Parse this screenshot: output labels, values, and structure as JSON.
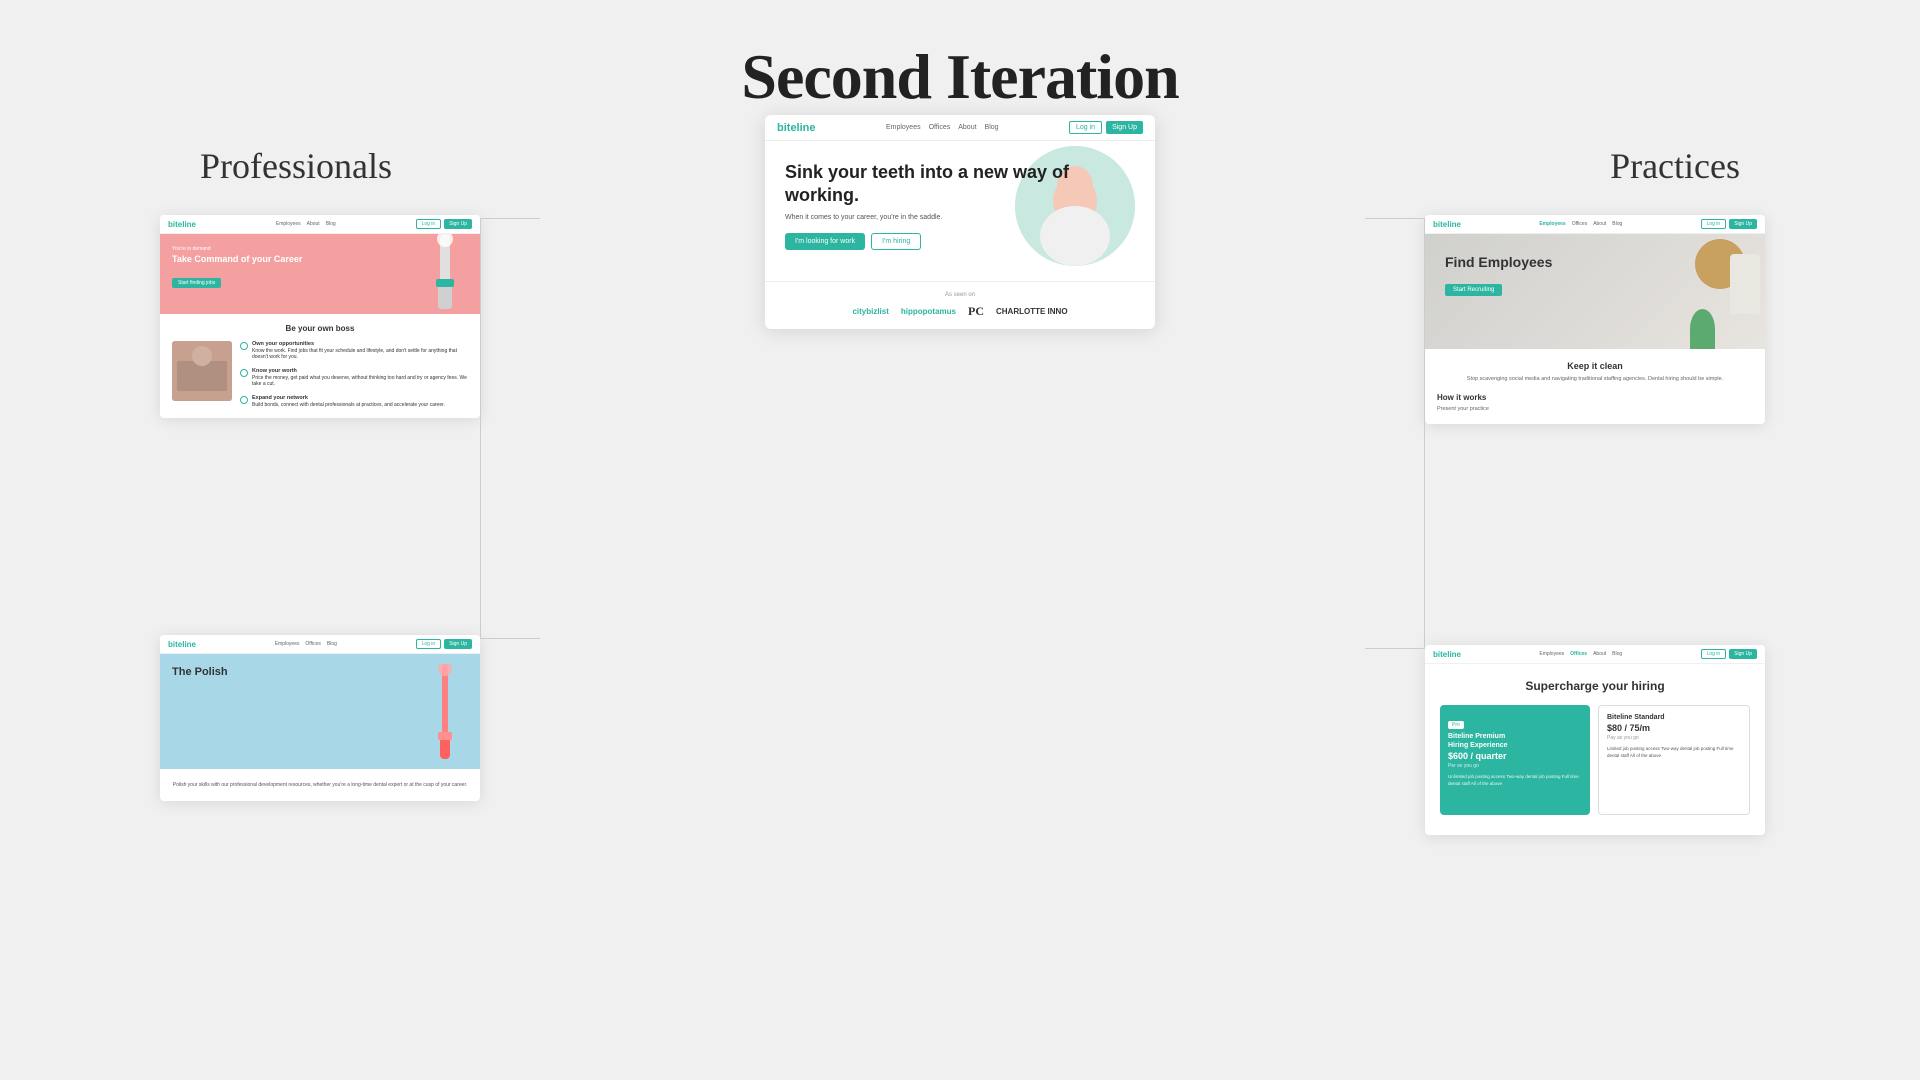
{
  "page": {
    "title": "Second Iteration",
    "background_color": "#f0f0f0"
  },
  "columns": {
    "left_label": "Professionals",
    "right_label": "Practices"
  },
  "center_card": {
    "logo": "biteline",
    "nav_links": [
      "Employees",
      "Offices",
      "About",
      "Blog"
    ],
    "nav_btn_login": "Log in",
    "nav_btn_signup": "Sign Up",
    "hero_heading": "Sink your teeth into a new way of working.",
    "hero_sub": "When it comes to your career, you're in the saddle.",
    "btn_looking": "I'm looking for work",
    "btn_hiring": "I'm hiring",
    "as_seen_label": "As seen on",
    "logos": [
      "citybizlist",
      "hippopotamus",
      "PC",
      "CHARLOTTE INNO"
    ]
  },
  "left_top_card": {
    "logo": "biteline",
    "nav_links": [
      "Employees",
      "About",
      "Blog"
    ],
    "nav_btn_login": "Log in",
    "nav_btn_signup": "Sign Up",
    "tag": "You're in demand",
    "heading": "Take Command of your Career",
    "btn_label": "Start finding jobs",
    "section_title": "Be your own boss",
    "feature1_title": "Own your opportunities",
    "feature1_desc": "Know the work. Find jobs that fit your schedule and lifestyle, and don't settle for anything that doesn't work for you.",
    "feature2_title": "Know your worth",
    "feature2_desc": "Price the money, get paid what you deserve, without thinking too hard and try or agency fees. We take a cut.",
    "feature3_title": "Expand your network",
    "feature3_desc": "Build bonds, connect with dental professionals at practices, and accelerate your career."
  },
  "left_bottom_card": {
    "logo": "biteline",
    "nav_links": [
      "Employees",
      "Offices",
      "Blog"
    ],
    "nav_btn_login": "Log in",
    "nav_btn_signup": "Sign Up",
    "hero_heading": "The Polish",
    "desc": "Polish your skills with our professional development resources, whether you're a long-time dental expert or at the cusp of your career."
  },
  "right_top_card": {
    "logo": "biteline",
    "nav_links": [
      "Employees",
      "Offices",
      "About",
      "Blog"
    ],
    "nav_btn_login": "Log in",
    "nav_btn_signup": "Sign Up",
    "hero_heading": "Find Employees",
    "hero_btn": "Start Recruiting",
    "section_title": "Keep it clean",
    "section_desc": "Stop scavenging social media and navigating traditional staffing agencies. Dental hiring should be simple.",
    "how_title": "How it works",
    "how_step": "Present your practice"
  },
  "right_bottom_card": {
    "logo": "biteline",
    "nav_links": [
      "Employees",
      "Offices",
      "About",
      "Blog"
    ],
    "nav_btn_login": "Log in",
    "nav_btn_signup": "Sign Up",
    "heading": "Supercharge your hiring",
    "plan1_badge": "Pro",
    "plan1_name": "Biteline Premium",
    "plan1_experience": "Hiring Experience",
    "plan1_price": "$600 / quarter",
    "plan1_period": "Per se you go",
    "plan1_features": "Unlimited job posting access\nTwo-way dental job posting\nFull time dental staff\nAll of the above",
    "plan2_name": "Biteline Standard",
    "plan2_price": "$80 / 75/m",
    "plan2_period": "Pay as you go",
    "plan2_features": "Limited job posting access\nTwo-way dental job posting\nFull time dental staff\nAll of the above"
  }
}
